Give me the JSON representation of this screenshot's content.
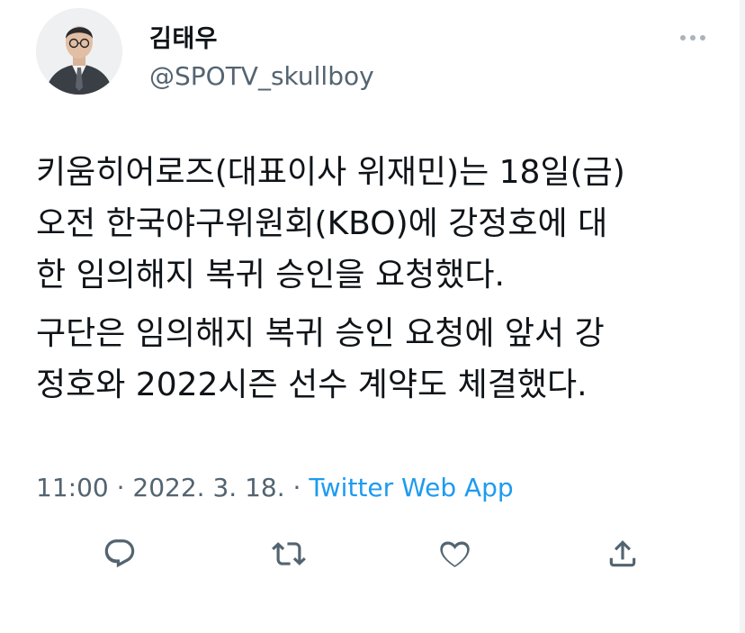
{
  "author": {
    "display_name": "김태우",
    "handle": "@SPOTV_skullboy",
    "avatar_icon": "profile-photo-avatar"
  },
  "tweet": {
    "paragraphs": [
      "키움히어로즈(대표이사 위재민)는 18일(금)\n오전 한국야구위원회(KBO)에 강정호에 대\n한 임의해지 복귀 승인을 요청했다.",
      "구단은 임의해지 복귀 승인 요청에 앞서 강\n정호와 2022시즌 선수 계약도 체결했다."
    ]
  },
  "meta": {
    "time": "11:00",
    "separator": " · ",
    "date": "2022. 3. 18.",
    "source": "Twitter Web App"
  },
  "icons": {
    "more": "more-horizontal-icon",
    "reply": "reply-icon",
    "retweet": "retweet-icon",
    "like": "heart-icon",
    "share": "share-icon"
  },
  "colors": {
    "text": "#0f1419",
    "secondary": "#536471",
    "link": "#1d9bf0"
  }
}
